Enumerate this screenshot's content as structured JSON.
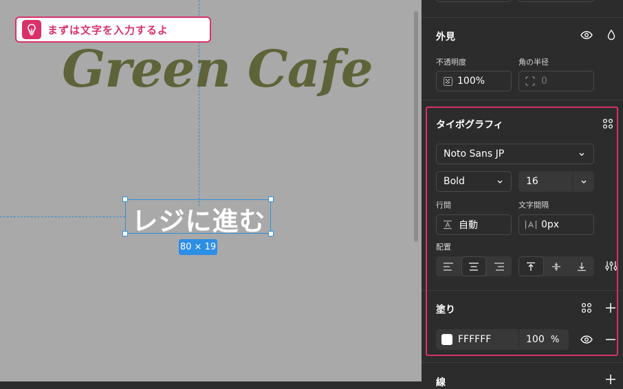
{
  "canvas": {
    "tip_text": "まずは文字を入力するよ",
    "logo_text": "Green Cafe",
    "selected_text": "レジに進む",
    "size_badge": "80 × 19"
  },
  "appearance": {
    "title": "外見",
    "opacity_label": "不透明度",
    "opacity_value": "100%",
    "radius_label": "角の半径",
    "radius_value": "0"
  },
  "typography": {
    "title": "タイポグラフィ",
    "font_family": "Noto Sans JP",
    "font_weight": "Bold",
    "font_size": "16",
    "line_height_label": "行間",
    "line_height_value": "自動",
    "letter_spacing_label": "文字間隔",
    "letter_spacing_value": "0px",
    "align_label": "配置"
  },
  "fill": {
    "title": "塗り",
    "color_hex": "FFFFFF",
    "opacity": "100",
    "percent": "%",
    "swatch_color": "#ffffff"
  },
  "stroke": {
    "title": "線"
  },
  "colors": {
    "accent": "#d8306a",
    "selection": "#2f8fd4",
    "logo": "#5f6339"
  }
}
